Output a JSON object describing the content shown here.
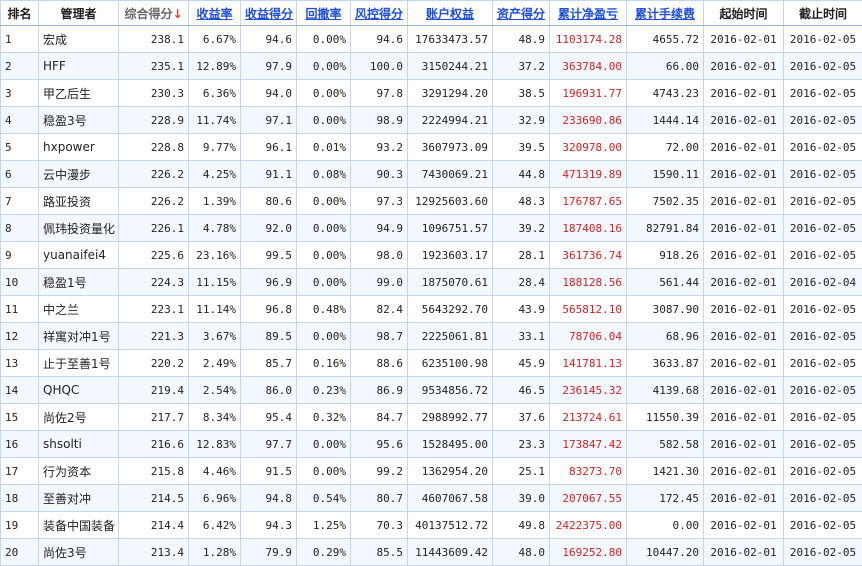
{
  "colors": {
    "accent_link": "#1f4fd6",
    "profit_red": "#d21f1f",
    "sort_arrow": "#e23a2e",
    "grid": "#c6d6ea"
  },
  "headers": {
    "rank": "排名",
    "manager": "管理者",
    "composite_score": "综合得分",
    "sort_arrow_icon": "↓",
    "return_rate": "收益率",
    "return_score": "收益得分",
    "drawdown": "回撤率",
    "risk_score": "风控得分",
    "equity": "账户权益",
    "asset_score": "资产得分",
    "cum_profit": "累计净盈亏",
    "cum_fee": "累计手续费",
    "start_date": "起始时间",
    "end_date": "截止时间"
  },
  "rows": [
    {
      "rank": "1",
      "manager": "宏成",
      "composite": "238.1",
      "return_rate": "6.67%",
      "return_score": "94.6",
      "drawdown": "0.00%",
      "risk_score": "94.6",
      "equity": "17633473.57",
      "asset_score": "48.9",
      "profit": "1103174.28",
      "fee": "4655.72",
      "start": "2016-02-01",
      "end": "2016-02-05"
    },
    {
      "rank": "2",
      "manager": "HFF",
      "composite": "235.1",
      "return_rate": "12.89%",
      "return_score": "97.9",
      "drawdown": "0.00%",
      "risk_score": "100.0",
      "equity": "3150244.21",
      "asset_score": "37.2",
      "profit": "363784.00",
      "fee": "66.00",
      "start": "2016-02-01",
      "end": "2016-02-05"
    },
    {
      "rank": "3",
      "manager": "甲乙后生",
      "composite": "230.3",
      "return_rate": "6.36%",
      "return_score": "94.0",
      "drawdown": "0.00%",
      "risk_score": "97.8",
      "equity": "3291294.20",
      "asset_score": "38.5",
      "profit": "196931.77",
      "fee": "4743.23",
      "start": "2016-02-01",
      "end": "2016-02-05"
    },
    {
      "rank": "4",
      "manager": "稳盈3号",
      "composite": "228.9",
      "return_rate": "11.74%",
      "return_score": "97.1",
      "drawdown": "0.00%",
      "risk_score": "98.9",
      "equity": "2224994.21",
      "asset_score": "32.9",
      "profit": "233690.86",
      "fee": "1444.14",
      "start": "2016-02-01",
      "end": "2016-02-05"
    },
    {
      "rank": "5",
      "manager": "hxpower",
      "composite": "228.8",
      "return_rate": "9.77%",
      "return_score": "96.1",
      "drawdown": "0.01%",
      "risk_score": "93.2",
      "equity": "3607973.09",
      "asset_score": "39.5",
      "profit": "320978.00",
      "fee": "72.00",
      "start": "2016-02-01",
      "end": "2016-02-05"
    },
    {
      "rank": "6",
      "manager": "云中漫步",
      "composite": "226.2",
      "return_rate": "4.25%",
      "return_score": "91.1",
      "drawdown": "0.08%",
      "risk_score": "90.3",
      "equity": "7430069.21",
      "asset_score": "44.8",
      "profit": "471319.89",
      "fee": "1590.11",
      "start": "2016-02-01",
      "end": "2016-02-05"
    },
    {
      "rank": "7",
      "manager": "路亚投资",
      "composite": "226.2",
      "return_rate": "1.39%",
      "return_score": "80.6",
      "drawdown": "0.00%",
      "risk_score": "97.3",
      "equity": "12925603.60",
      "asset_score": "48.3",
      "profit": "176787.65",
      "fee": "7502.35",
      "start": "2016-02-01",
      "end": "2016-02-05"
    },
    {
      "rank": "8",
      "manager": "佩玮投资量化",
      "composite": "226.1",
      "return_rate": "4.78%",
      "return_score": "92.0",
      "drawdown": "0.00%",
      "risk_score": "94.9",
      "equity": "1096751.57",
      "asset_score": "39.2",
      "profit": "187408.16",
      "fee": "82791.84",
      "start": "2016-02-01",
      "end": "2016-02-05"
    },
    {
      "rank": "9",
      "manager": "yuanaifei4",
      "composite": "225.6",
      "return_rate": "23.16%",
      "return_score": "99.5",
      "drawdown": "0.00%",
      "risk_score": "98.0",
      "equity": "1923603.17",
      "asset_score": "28.1",
      "profit": "361736.74",
      "fee": "918.26",
      "start": "2016-02-01",
      "end": "2016-02-05"
    },
    {
      "rank": "10",
      "manager": "稳盈1号",
      "composite": "224.3",
      "return_rate": "11.15%",
      "return_score": "96.9",
      "drawdown": "0.00%",
      "risk_score": "99.0",
      "equity": "1875070.61",
      "asset_score": "28.4",
      "profit": "188128.56",
      "fee": "561.44",
      "start": "2016-02-01",
      "end": "2016-02-04"
    },
    {
      "rank": "11",
      "manager": "中之兰",
      "composite": "223.1",
      "return_rate": "11.14%",
      "return_score": "96.8",
      "drawdown": "0.48%",
      "risk_score": "82.4",
      "equity": "5643292.70",
      "asset_score": "43.9",
      "profit": "565812.10",
      "fee": "3087.90",
      "start": "2016-02-01",
      "end": "2016-02-05"
    },
    {
      "rank": "12",
      "manager": "祥寓对冲1号",
      "composite": "221.3",
      "return_rate": "3.67%",
      "return_score": "89.5",
      "drawdown": "0.00%",
      "risk_score": "98.7",
      "equity": "2225061.81",
      "asset_score": "33.1",
      "profit": "78706.04",
      "fee": "68.96",
      "start": "2016-02-01",
      "end": "2016-02-05"
    },
    {
      "rank": "13",
      "manager": "止于至善1号",
      "composite": "220.2",
      "return_rate": "2.49%",
      "return_score": "85.7",
      "drawdown": "0.16%",
      "risk_score": "88.6",
      "equity": "6235100.98",
      "asset_score": "45.9",
      "profit": "141781.13",
      "fee": "3633.87",
      "start": "2016-02-01",
      "end": "2016-02-05"
    },
    {
      "rank": "14",
      "manager": "QHQC",
      "composite": "219.4",
      "return_rate": "2.54%",
      "return_score": "86.0",
      "drawdown": "0.23%",
      "risk_score": "86.9",
      "equity": "9534856.72",
      "asset_score": "46.5",
      "profit": "236145.32",
      "fee": "4139.68",
      "start": "2016-02-01",
      "end": "2016-02-05"
    },
    {
      "rank": "15",
      "manager": "尚佐2号",
      "composite": "217.7",
      "return_rate": "8.34%",
      "return_score": "95.4",
      "drawdown": "0.32%",
      "risk_score": "84.7",
      "equity": "2988992.77",
      "asset_score": "37.6",
      "profit": "213724.61",
      "fee": "11550.39",
      "start": "2016-02-01",
      "end": "2016-02-05"
    },
    {
      "rank": "16",
      "manager": "shsolti",
      "composite": "216.6",
      "return_rate": "12.83%",
      "return_score": "97.7",
      "drawdown": "0.00%",
      "risk_score": "95.6",
      "equity": "1528495.00",
      "asset_score": "23.3",
      "profit": "173847.42",
      "fee": "582.58",
      "start": "2016-02-01",
      "end": "2016-02-05"
    },
    {
      "rank": "17",
      "manager": "行为资本",
      "composite": "215.8",
      "return_rate": "4.46%",
      "return_score": "91.5",
      "drawdown": "0.00%",
      "risk_score": "99.2",
      "equity": "1362954.20",
      "asset_score": "25.1",
      "profit": "83273.70",
      "fee": "1421.30",
      "start": "2016-02-01",
      "end": "2016-02-05"
    },
    {
      "rank": "18",
      "manager": "至善对冲",
      "composite": "214.5",
      "return_rate": "6.96%",
      "return_score": "94.8",
      "drawdown": "0.54%",
      "risk_score": "80.7",
      "equity": "4607067.58",
      "asset_score": "39.0",
      "profit": "207067.55",
      "fee": "172.45",
      "start": "2016-02-01",
      "end": "2016-02-05"
    },
    {
      "rank": "19",
      "manager": "装备中国装备",
      "composite": "214.4",
      "return_rate": "6.42%",
      "return_score": "94.3",
      "drawdown": "1.25%",
      "risk_score": "70.3",
      "equity": "40137512.72",
      "asset_score": "49.8",
      "profit": "2422375.00",
      "fee": "0.00",
      "start": "2016-02-01",
      "end": "2016-02-05"
    },
    {
      "rank": "20",
      "manager": "尚佐3号",
      "composite": "213.4",
      "return_rate": "1.28%",
      "return_score": "79.9",
      "drawdown": "0.29%",
      "risk_score": "85.5",
      "equity": "11443609.42",
      "asset_score": "48.0",
      "profit": "169252.80",
      "fee": "10447.20",
      "start": "2016-02-01",
      "end": "2016-02-05"
    }
  ]
}
